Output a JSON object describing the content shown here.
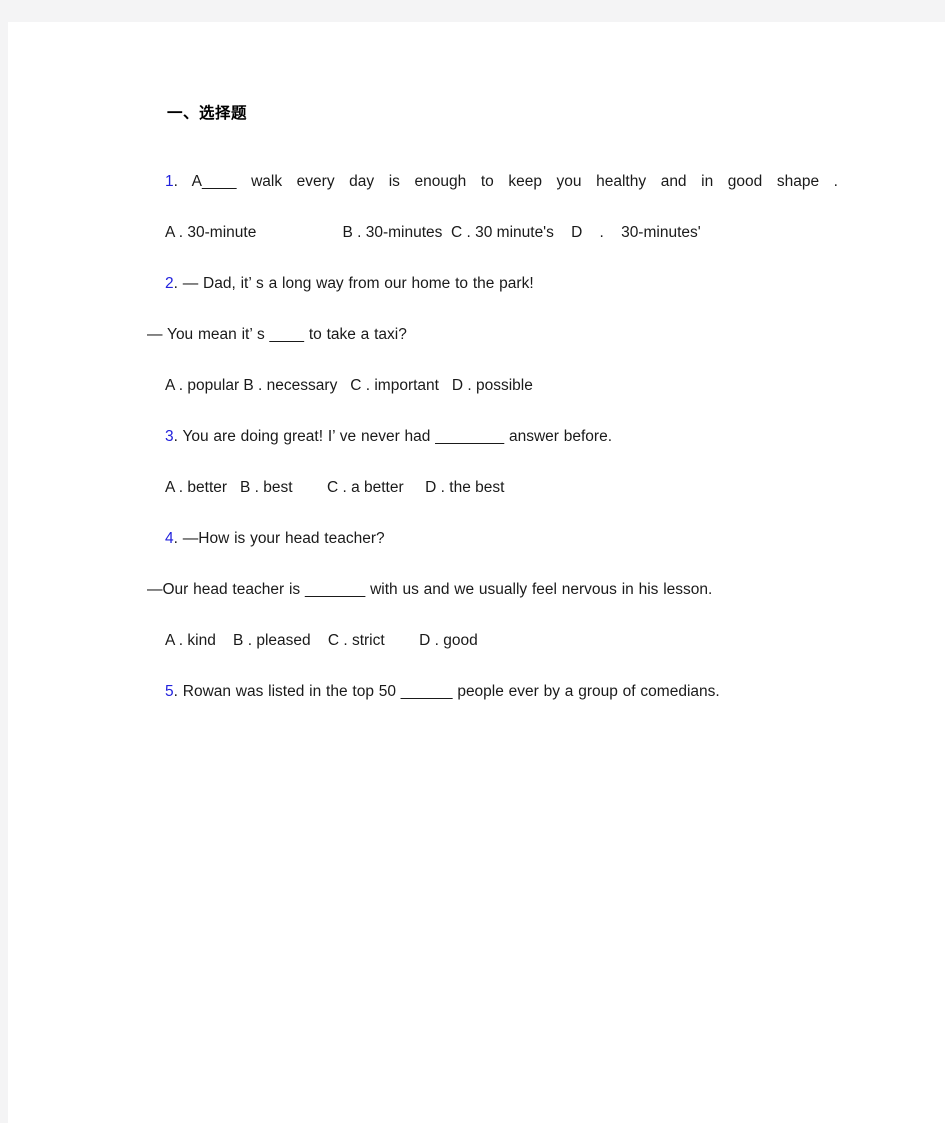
{
  "document": {
    "section_heading": "一、选择题",
    "questions": [
      {
        "number": "1",
        "dot": ".",
        "stem_lines": [
          "A____  walk every day is enough to keep you healthy and in good shape ."
        ],
        "options_text": "A . 30-minute                    B . 30-minutes  C . 30 minute's    D    .    30-minutes'"
      },
      {
        "number": "2",
        "dot": ".",
        "stem_lines": [
          "— Dad, it’ s a long way from our home to the park!",
          "— You mean it’ s ____ to take a taxi?"
        ],
        "options_text": "A . popular B . necessary   C . important   D . possible"
      },
      {
        "number": "3",
        "dot": ".",
        "stem_lines": [
          "You are doing great! I’ ve never had ________ answer before."
        ],
        "options_text": "A . better   B . best        C . a better     D . the best"
      },
      {
        "number": "4",
        "dot": ".",
        "stem_lines": [
          "—How is your head teacher?",
          "—Our head teacher is _______ with us and we usually feel nervous in his lesson."
        ],
        "options_text": "A . kind    B . pleased    C . strict        D . good"
      },
      {
        "number": "5",
        "dot": ".",
        "stem_lines": [
          "Rowan was listed in the top 50 ______ people ever by a group of comedians."
        ],
        "options_text": ""
      }
    ]
  },
  "colors": {
    "question_number": "#2222dd",
    "body_text": "#1a1a1a",
    "page_background": "#ffffff",
    "outer_background": "#f4f4f5"
  }
}
